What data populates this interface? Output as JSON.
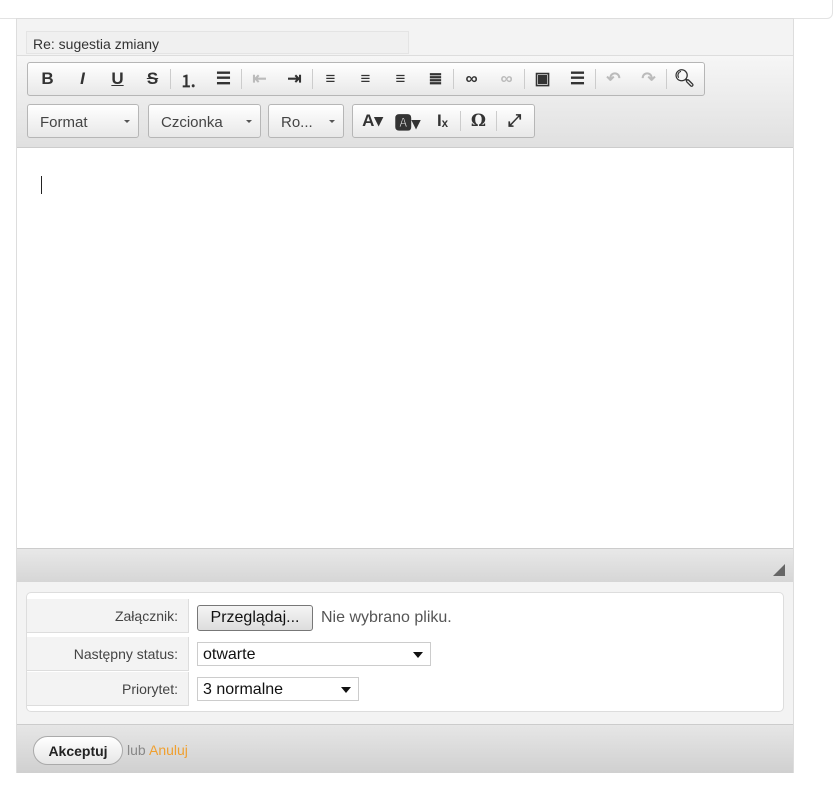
{
  "subject": "Re: sugestia zmiany",
  "toolbar": {
    "row1": [
      {
        "name": "bold",
        "glyph": "B",
        "enabled": true
      },
      {
        "name": "italic",
        "glyph": "I",
        "enabled": true
      },
      {
        "name": "underline",
        "glyph": "U",
        "enabled": true
      },
      {
        "name": "strikethrough",
        "glyph": "S",
        "enabled": true
      },
      "sep",
      {
        "name": "numbered-list",
        "glyph": "⒈",
        "enabled": true
      },
      {
        "name": "bulleted-list",
        "glyph": "☰",
        "enabled": true
      },
      "sep",
      {
        "name": "outdent",
        "glyph": "⇤",
        "enabled": false
      },
      {
        "name": "indent",
        "glyph": "⇥",
        "enabled": true
      },
      "sep",
      {
        "name": "align-left",
        "glyph": "≡",
        "enabled": true
      },
      {
        "name": "align-center",
        "glyph": "≡",
        "enabled": true
      },
      {
        "name": "align-right",
        "glyph": "≡",
        "enabled": true
      },
      {
        "name": "justify",
        "glyph": "≣",
        "enabled": true
      },
      "sep",
      {
        "name": "link",
        "glyph": "∞",
        "enabled": true
      },
      {
        "name": "unlink",
        "glyph": "∞",
        "enabled": false
      },
      "sep",
      {
        "name": "image",
        "glyph": "▣",
        "enabled": true
      },
      {
        "name": "horizontal-line",
        "glyph": "☰",
        "enabled": true
      },
      "sep",
      {
        "name": "undo",
        "glyph": "↶",
        "enabled": false
      },
      {
        "name": "redo",
        "glyph": "↷",
        "enabled": false
      },
      "sep",
      {
        "name": "search",
        "glyph": "🔍︎",
        "enabled": true
      }
    ],
    "format_label": "Format",
    "font_label": "Czcionka",
    "size_label": "Ro...",
    "row2": [
      {
        "name": "text-color",
        "glyph": "A▾"
      },
      {
        "name": "background-color",
        "glyph": "🅰▾"
      },
      {
        "name": "remove-format",
        "glyph": "Iₓ"
      },
      "sep",
      {
        "name": "special-char",
        "glyph": "Ω"
      },
      "sep",
      {
        "name": "maximize",
        "glyph": "⤢"
      }
    ]
  },
  "form": {
    "attachment_label": "Załącznik:",
    "browse_label": "Przeglądaj...",
    "no_file": "Nie wybrano pliku.",
    "status_label": "Następny status:",
    "status_value": "otwarte",
    "priority_label": "Priorytet:",
    "priority_value": "3 normalne"
  },
  "footer": {
    "accept_label": "Akceptuj",
    "or_text": "lub",
    "cancel_label": "Anuluj"
  },
  "colors": {
    "cancel_link": "#f0a030"
  }
}
